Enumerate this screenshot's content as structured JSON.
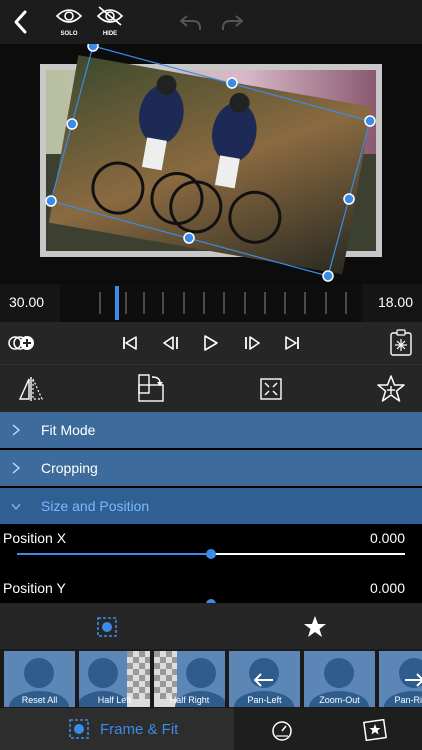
{
  "toolbar": {
    "solo_label": "SOLO",
    "hide_label": "HIDE"
  },
  "timeline": {
    "start_value": "30.00",
    "end_value": "18.00"
  },
  "sections": [
    {
      "label": "Fit Mode",
      "expanded": false
    },
    {
      "label": "Cropping",
      "expanded": false
    },
    {
      "label": "Size and Position",
      "expanded": true
    }
  ],
  "params": {
    "position_x": {
      "label": "Position X",
      "value": "0.000",
      "level": 0.5
    },
    "position_y": {
      "label": "Position Y",
      "value": "0.000",
      "level": 0.5
    }
  },
  "presets": [
    {
      "label": "Reset All"
    },
    {
      "label": "Half Left"
    },
    {
      "label": "Half Right"
    },
    {
      "label": "Pan-Left"
    },
    {
      "label": "Zoom-Out"
    },
    {
      "label": "Pan-Right"
    }
  ],
  "bottom_nav": {
    "frame_fit_label": "Frame & Fit"
  },
  "colors": {
    "accent": "#3b8be8",
    "section_bg": "#3c6b9c",
    "section_open_text": "#7db8ff"
  }
}
